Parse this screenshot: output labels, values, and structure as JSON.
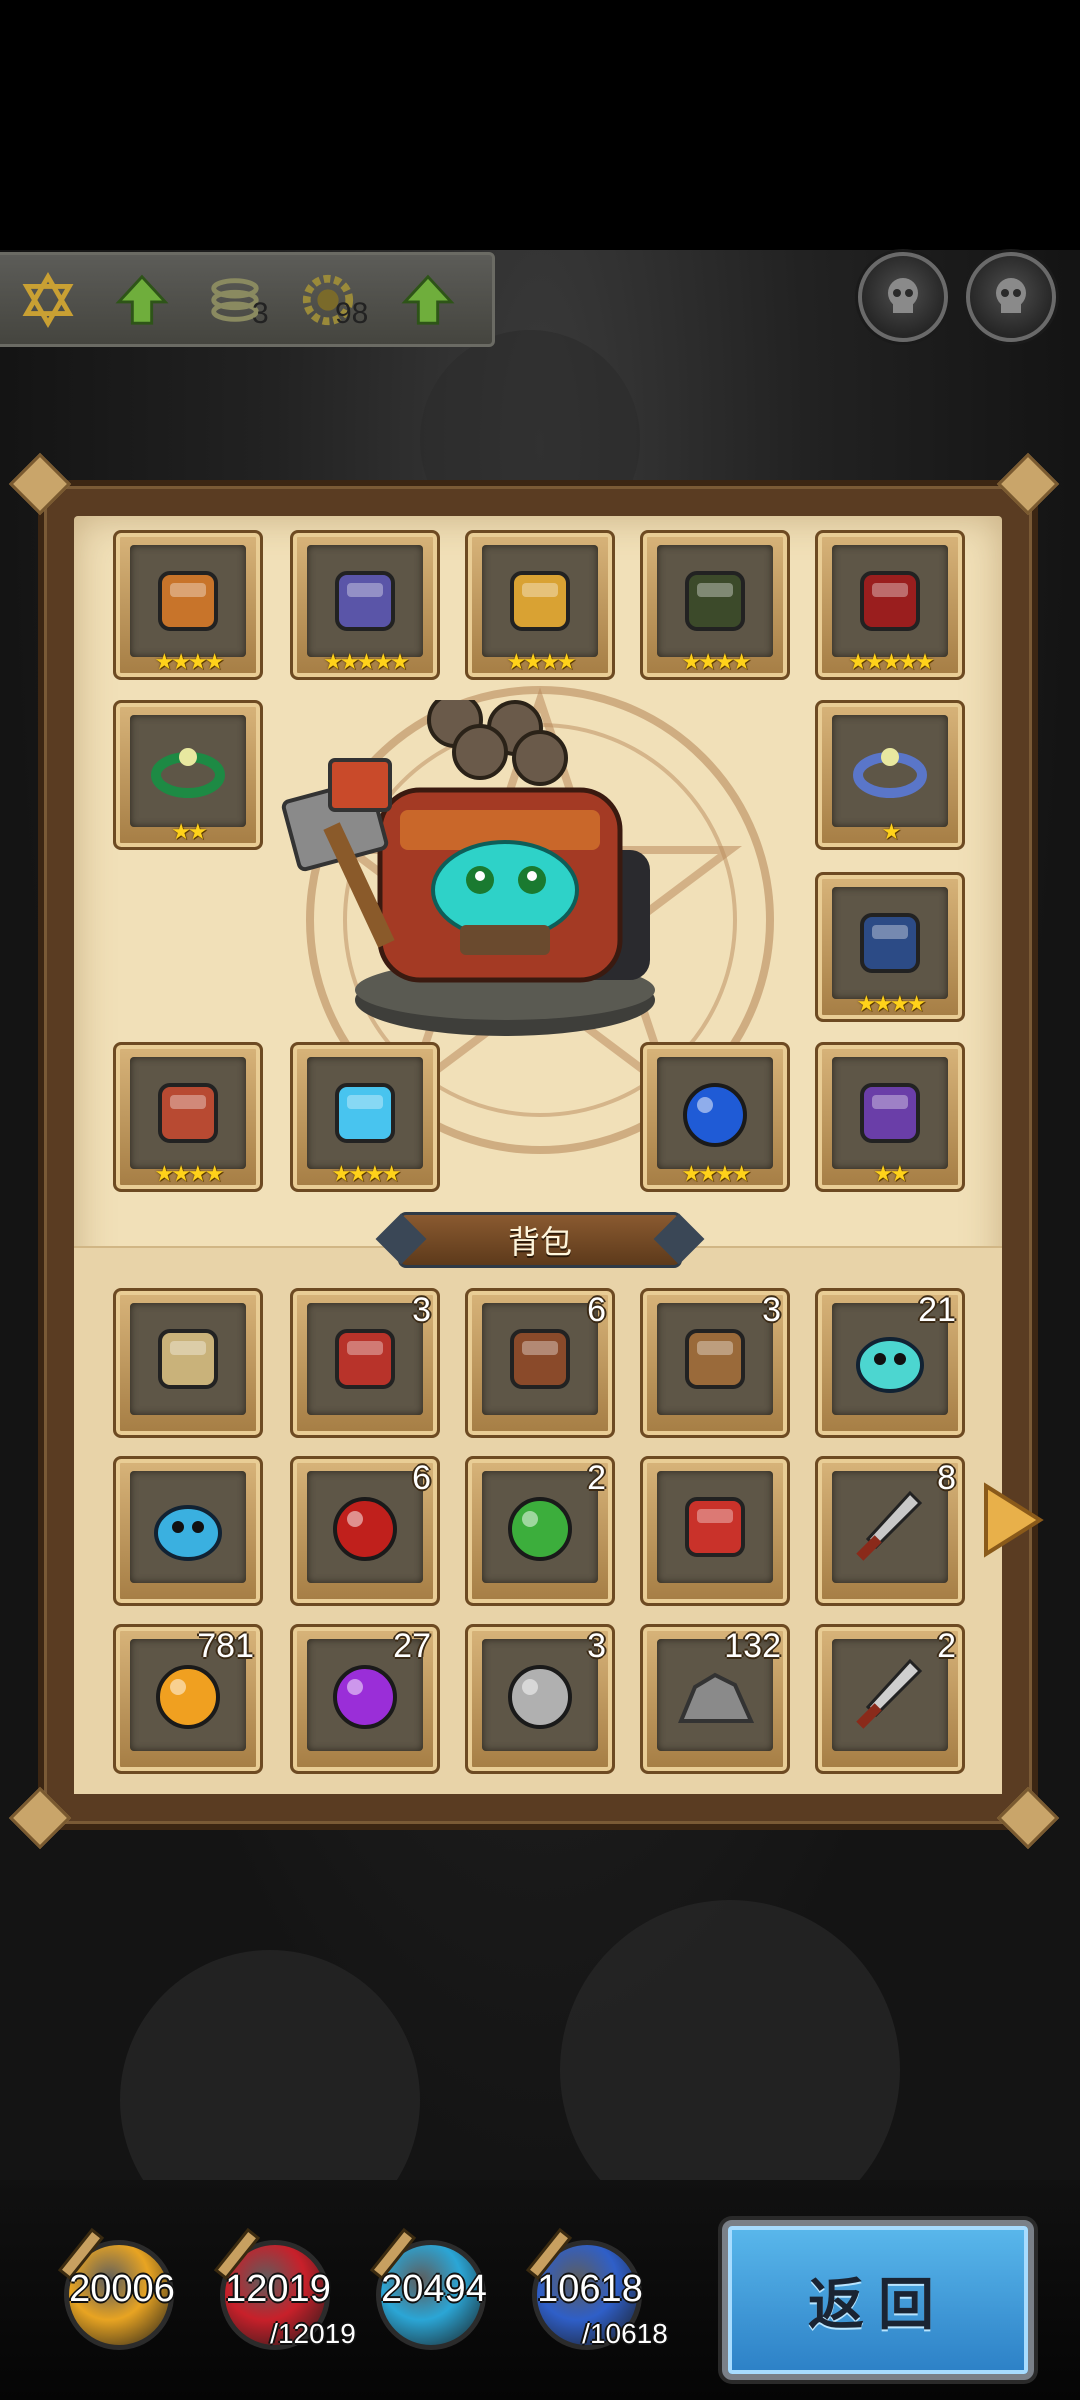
{
  "status_bar": {
    "icons": [
      "hexagram-icon",
      "upgrade-arrow-icon",
      "coil-icon",
      "gear-skull-icon",
      "upgrade-arrow-icon"
    ],
    "coil_count": "3",
    "gear_count": "98"
  },
  "top_buttons": [
    "skull-button",
    "skull-button-2"
  ],
  "equipment": [
    {
      "icon": "bracer-icon",
      "stars": "★★★★",
      "color": "#c8742a"
    },
    {
      "icon": "armor-icon",
      "stars": "★★★★★",
      "color": "#5a55a8"
    },
    {
      "icon": "gauntlet-icon",
      "stars": "★★★★",
      "color": "#d9a233"
    },
    {
      "icon": "cauldron-icon",
      "stars": "★★★★",
      "color": "#3c4a2a"
    },
    {
      "icon": "beads-icon",
      "stars": "★★★★★",
      "color": "#9a1e1e"
    },
    {
      "icon": "green-ring-icon",
      "stars": "★★",
      "color": "#1d8a44"
    },
    {
      "icon": "sapphire-ring-icon",
      "stars": "★",
      "color": "#5a76c9"
    },
    {
      "icon": "helmet-icon",
      "stars": "★★★★",
      "color": "#2c4b86"
    },
    {
      "icon": "hammer-icon",
      "stars": "★★★★",
      "color": "#b84a32"
    },
    {
      "icon": "ice-cube-icon",
      "stars": "★★★★",
      "color": "#48c4ef"
    },
    {
      "icon": "blue-eye-orb-icon",
      "stars": "★★★★",
      "color": "#1f5bd6"
    },
    {
      "icon": "boots-icon",
      "stars": "★★",
      "color": "#6a3ea8"
    }
  ],
  "bag_title": "背包",
  "bag": [
    {
      "icon": "map-scroll-icon",
      "count": "",
      "color": "#c9b27a"
    },
    {
      "icon": "bat-demon-icon",
      "count": "3",
      "color": "#b8332a"
    },
    {
      "icon": "scroll-icon",
      "count": "6",
      "color": "#8a4a2a"
    },
    {
      "icon": "whip-icon",
      "count": "3",
      "color": "#9a6a3a"
    },
    {
      "icon": "cyan-slime-icon",
      "count": "21",
      "color": "#4cd6d0"
    },
    {
      "icon": "hero-portrait-icon",
      "count": "",
      "color": "#3ab0e0"
    },
    {
      "icon": "apple-icon",
      "count": "6",
      "color": "#c0201c"
    },
    {
      "icon": "green-compass-icon",
      "count": "2",
      "color": "#3cae3c"
    },
    {
      "icon": "red-card-icon",
      "count": "",
      "color": "#c9322a"
    },
    {
      "icon": "dagger-icon",
      "count": "8",
      "color": "#c8c8c8"
    },
    {
      "icon": "orange-orb-icon",
      "count": "781",
      "color": "#f0a020"
    },
    {
      "icon": "purple-orb-icon",
      "count": "27",
      "color": "#9a2ed8"
    },
    {
      "icon": "silver-coin-icon",
      "count": "3",
      "color": "#b0b0b0"
    },
    {
      "icon": "ore-icon",
      "count": "132",
      "color": "#8a8a8a"
    },
    {
      "icon": "sword-icon",
      "count": "2",
      "color": "#cfcfcf"
    }
  ],
  "resources": [
    {
      "name": "gold-potion",
      "value": "20006",
      "max": "",
      "color": "#e8a422"
    },
    {
      "name": "red-potion",
      "value": "12019",
      "max": "/12019",
      "color": "#c8202a"
    },
    {
      "name": "cyan-potion",
      "value": "20494",
      "max": "",
      "color": "#2ba6d6"
    },
    {
      "name": "blue-potion",
      "value": "10618",
      "max": "/10618",
      "color": "#2f5fc8"
    }
  ],
  "return_label": "返回"
}
